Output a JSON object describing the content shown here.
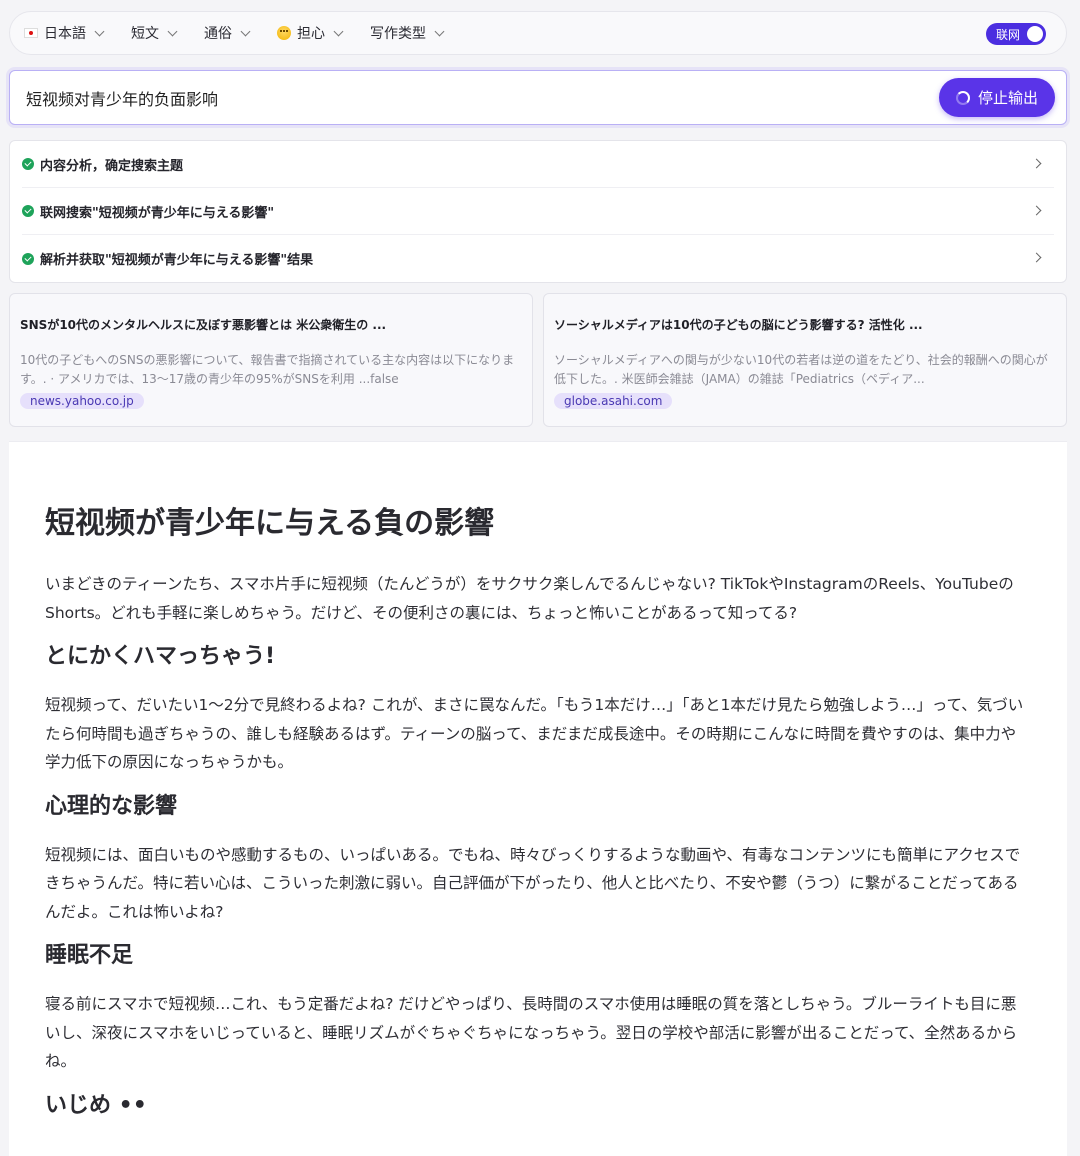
{
  "toolbar": {
    "language": "日本語",
    "length": "短文",
    "style": "通俗",
    "tone": "担心",
    "writing_type": "写作类型",
    "network_toggle": {
      "label": "联网",
      "on": true
    }
  },
  "search": {
    "query": "短视频对青少年的负面影响",
    "stop_label": "停止输出"
  },
  "steps": [
    {
      "label": "内容分析，确定搜索主题",
      "done": true
    },
    {
      "label": "联网搜索\"短视频が青少年に与える影響\"",
      "done": true
    },
    {
      "label": "解析并获取\"短视频が青少年に与える影響\"结果",
      "done": true
    }
  ],
  "sources": [
    {
      "title": "SNSが10代のメンタルヘルスに及ぼす悪影響とは 米公衆衛生の ...",
      "snippet": "10代の子どもへのSNSの悪影響について、報告書で指摘されている主な内容は以下になります。. · アメリカでは、13～17歳の青少年の95%がSNSを利用 ...false",
      "domain": "news.yahoo.co.jp"
    },
    {
      "title": "ソーシャルメディアは10代の子どもの脳にどう影響する? 活性化 ...",
      "snippet": "ソーシャルメディアへの関与が少ない10代の若者は逆の道をたどり、社会的報酬への関心が低下した。. 米医師会雑誌（JAMA）の雑誌「Pediatrics（ペディア...",
      "domain": "globe.asahi.com"
    }
  ],
  "article": {
    "title": "短视频が青少年に与える負の影響",
    "intro": "いまどきのティーンたち、スマホ片手に短视频（たんどうが）をサクサク楽しんでるんじゃない? TikTokやInstagramのReels、YouTubeのShorts。どれも手軽に楽しめちゃう。だけど、その便利さの裏には、ちょっと怖いことがあるって知ってる?",
    "sections": [
      {
        "heading": "とにかくハマっちゃう!",
        "body": "短视频って、だいたい1～2分で見終わるよね? これが、まさに罠なんだ。「もう1本だけ…」「あと1本だけ見たら勉強しよう…」って、気づいたら何時間も過ぎちゃうの、誰しも経験あるはず。ティーンの脳って、まだまだ成長途中。その時期にこんなに時間を費やすのは、集中力や学力低下の原因になっちゃうかも。"
      },
      {
        "heading": "心理的な影響",
        "body": "短视频には、面白いものや感動するもの、いっぱいある。でもね、時々びっくりするような動画や、有毒なコンテンツにも簡単にアクセスできちゃうんだ。特に若い心は、こういった刺激に弱い。自己評価が下がったり、他人と比べたり、不安や鬱（うつ）に繋がることだってあるんだよ。これは怖いよね?"
      },
      {
        "heading": "睡眠不足",
        "body": "寝る前にスマホで短视频…これ、もう定番だよね? だけどやっぱり、長時間のスマホ使用は睡眠の質を落としちゃう。ブルーライトも目に悪いし、深夜にスマホをいじっていると、睡眠リズムがぐちゃぐちゃになっちゃう。翌日の学校や部活に影響が出ることだって、全然あるからね。"
      },
      {
        "heading": "いじめ ••",
        "body": ""
      }
    ]
  },
  "colors": {
    "accent": "#5a34e8",
    "toggle": "#4b2ee0",
    "check": "#1ea35a",
    "domain_chip_bg": "#e6e0fb"
  }
}
